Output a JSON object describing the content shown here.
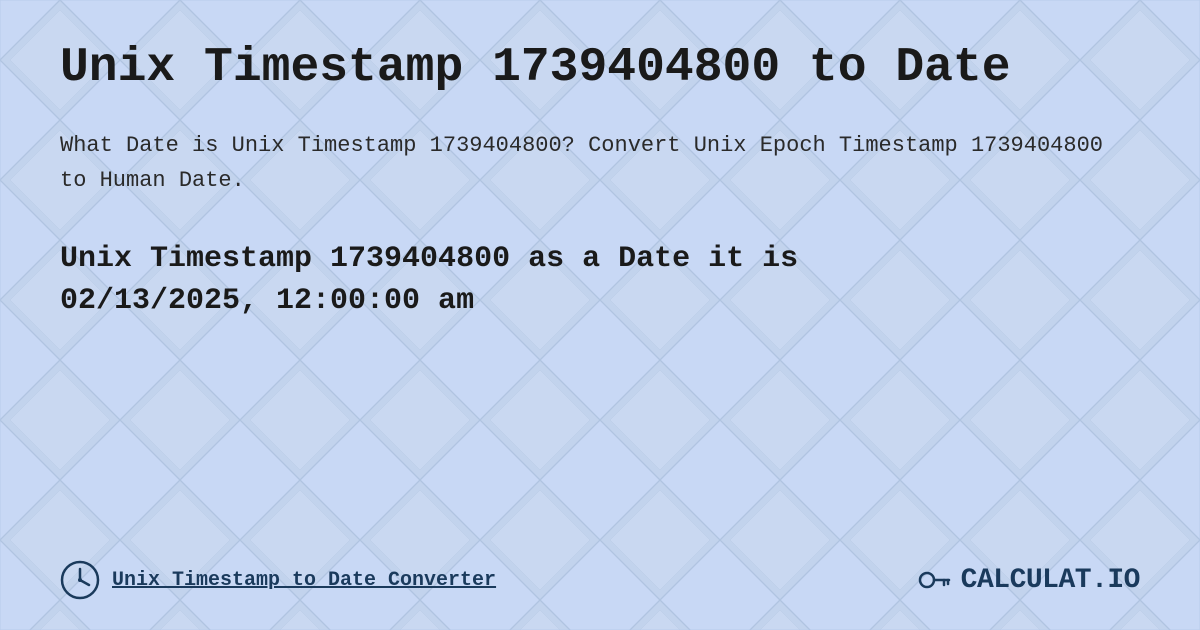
{
  "page": {
    "title": "Unix Timestamp 1739404800 to Date",
    "description": "What Date is Unix Timestamp 1739404800? Convert Unix Epoch Timestamp 1739404800 to Human Date.",
    "result_line1": "Unix Timestamp 1739404800 as a Date it is",
    "result_line2": "02/13/2025, 12:00:00 am",
    "footer_link": "Unix Timestamp to Date Converter",
    "logo_text": "CALCULAT.IO",
    "bg_color": "#c8d8ee"
  }
}
